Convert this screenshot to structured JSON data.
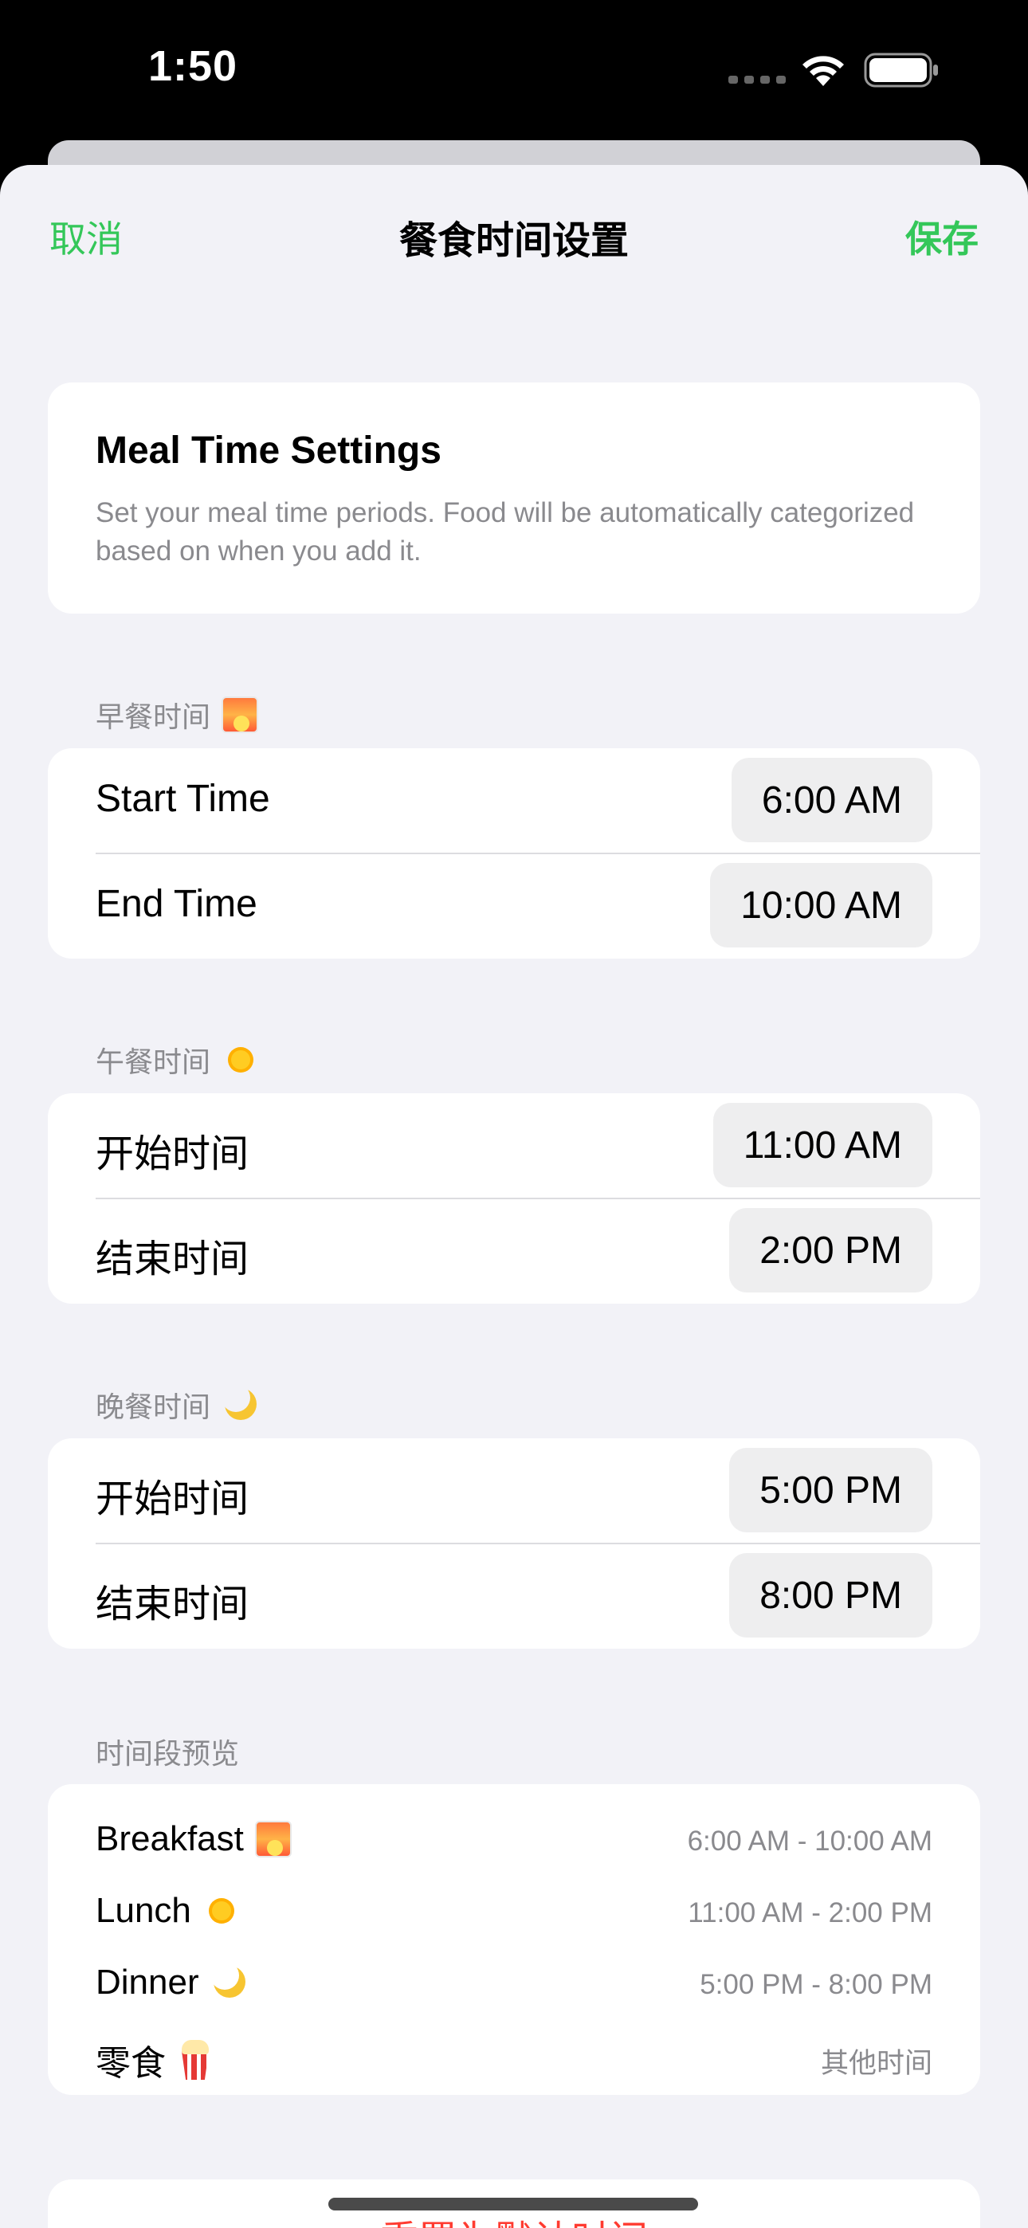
{
  "status_bar": {
    "time": "1:50"
  },
  "nav": {
    "cancel": "取消",
    "title": "餐食时间设置",
    "save": "保存"
  },
  "info": {
    "title": "Meal Time Settings",
    "description": "Set your meal time periods. Food will be automatically categorized based on when you add it."
  },
  "breakfast": {
    "header": "早餐时间",
    "icon": "sunrise-icon",
    "start_label": "Start Time",
    "start_value": "6:00 AM",
    "end_label": "End Time",
    "end_value": "10:00 AM"
  },
  "lunch": {
    "header": "午餐时间",
    "icon": "sun-icon",
    "start_label": "开始时间",
    "start_value": "11:00 AM",
    "end_label": "结束时间",
    "end_value": "2:00 PM"
  },
  "dinner": {
    "header": "晚餐时间",
    "icon": "moon-icon",
    "start_label": "开始时间",
    "start_value": "5:00 PM",
    "end_label": "结束时间",
    "end_value": "8:00 PM"
  },
  "preview": {
    "header": "时间段预览",
    "items": [
      {
        "name": "Breakfast",
        "icon": "sunrise-icon",
        "range": "6:00 AM - 10:00 AM"
      },
      {
        "name": "Lunch",
        "icon": "sun-icon",
        "range": "11:00 AM - 2:00 PM"
      },
      {
        "name": "Dinner",
        "icon": "moon-icon",
        "range": "5:00 PM - 8:00 PM"
      },
      {
        "name": "零食",
        "icon": "popcorn-icon",
        "range": "其他时间"
      }
    ]
  },
  "reset": {
    "label": "重置为默认时间"
  },
  "colors": {
    "accent": "#34c759",
    "destructive": "#ff3b30",
    "background": "#f2f2f7"
  }
}
